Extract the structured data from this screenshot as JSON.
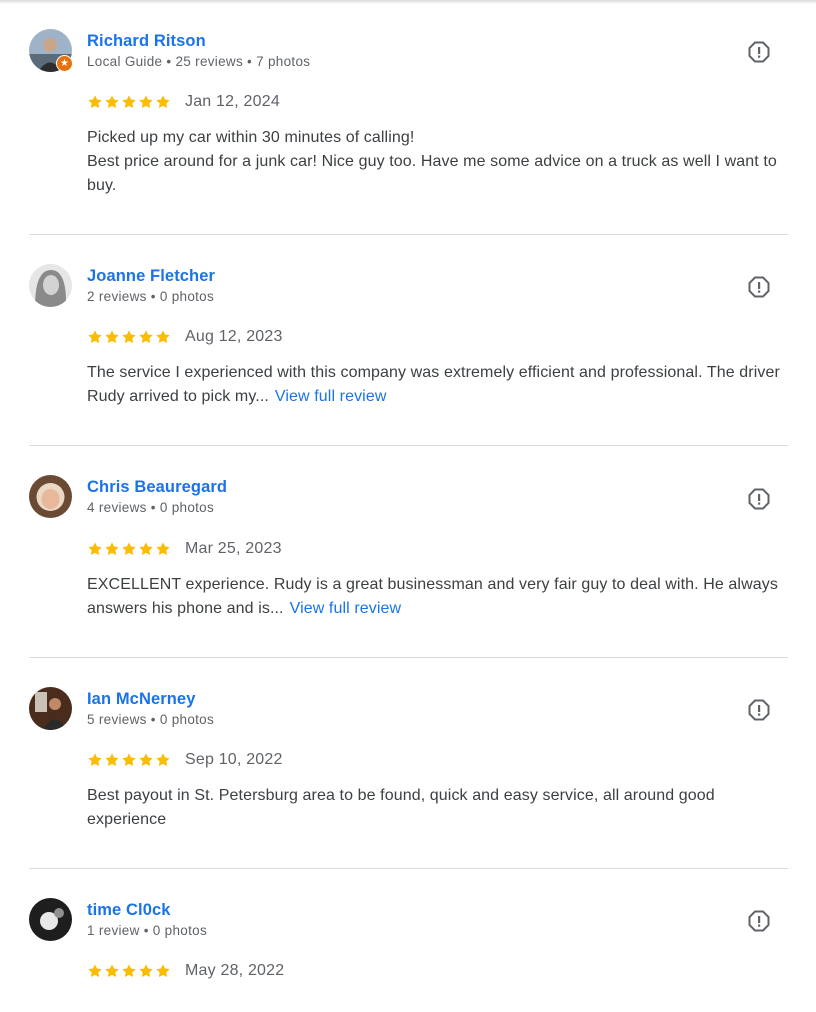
{
  "reviews": [
    {
      "name": "Richard Ritson",
      "meta": "Local Guide • 25 reviews • 7 photos",
      "date": "Jan 12, 2024",
      "rating": 5,
      "text_lines": [
        "Picked up my car within 30 minutes of calling!",
        "Best price around for a junk car! Nice guy too. Have me some advice on a truck as well I want to buy."
      ],
      "more_label": ""
    },
    {
      "name": "Joanne Fletcher",
      "meta": "2 reviews • 0 photos",
      "date": "Aug 12, 2023",
      "rating": 5,
      "text": "The service I experienced with this company was extremely efficient and professional. The driver Rudy arrived to pick my...",
      "more_label": "View full review"
    },
    {
      "name": "Chris Beauregard",
      "meta": "4 reviews • 0 photos",
      "date": "Mar 25, 2023",
      "rating": 5,
      "text": "EXCELLENT experience. Rudy is a great businessman and very fair guy to deal with. He always answers his phone and is...",
      "more_label": "View full review"
    },
    {
      "name": "Ian McNerney",
      "meta": "5 reviews • 0 photos",
      "date": "Sep 10, 2022",
      "rating": 5,
      "text": "Best payout in St. Petersburg area to be found, quick and easy service, all around good experience",
      "more_label": ""
    },
    {
      "name": "time Cl0ck",
      "meta": "1 review • 0 photos",
      "date": "May 28, 2022",
      "rating": 5,
      "text": "",
      "more_label": ""
    }
  ],
  "icons": {
    "star": "star-icon",
    "report": "report-icon",
    "badge": "local-guide-badge-icon"
  },
  "colors": {
    "star": "#fbbc04",
    "name": "#1a73e8",
    "badge": "#e8710a",
    "link": "#1a73e8"
  }
}
